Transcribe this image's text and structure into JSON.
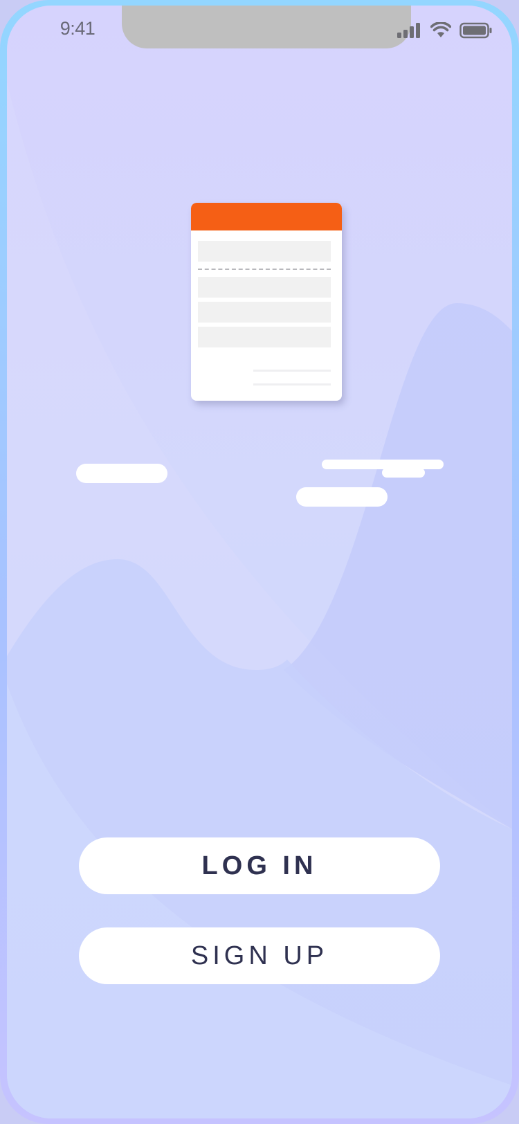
{
  "status_bar": {
    "time": "9:41",
    "signal_icon": "cellular-signal-icon",
    "wifi_icon": "wifi-icon",
    "battery_icon": "battery-icon"
  },
  "illustration": {
    "document_icon": "document-receipt-icon",
    "header_color": "#f55f15"
  },
  "actions": {
    "login_label": "LOG IN",
    "signup_label": "SIGN UP"
  },
  "colors": {
    "background_top": "#d6d3fd",
    "background_bottom": "#ccd6fd",
    "button_text": "#2f3150",
    "button_bg": "#ffffff"
  }
}
